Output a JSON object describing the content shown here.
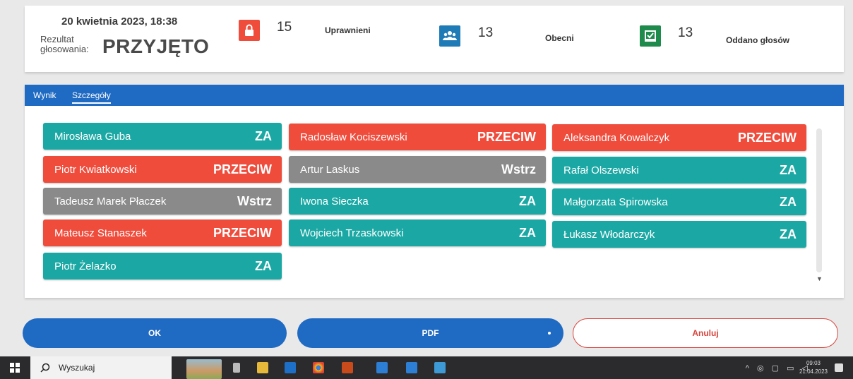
{
  "header": {
    "date": "20 kwietnia 2023, 18:38",
    "result_label": "Rezultat\ngłosowania:",
    "result_value": "PRZYJĘTO",
    "stats": [
      {
        "icon": "lock-icon",
        "count": "15",
        "label": "Uprawnieni",
        "color": "#ef4c3c"
      },
      {
        "icon": "users-icon",
        "count": "13",
        "label": "Obecni",
        "color": "#1f7bb6"
      },
      {
        "icon": "checkbox-icon",
        "count": "13",
        "label": "Oddano głosów",
        "color": "#1e8a4c"
      }
    ]
  },
  "tabs": {
    "result": "Wynik",
    "details": "Szczegóły"
  },
  "votes": [
    {
      "name": "Mirosława Guba",
      "vote": "ZA"
    },
    {
      "name": "Piotr Kwiatkowski",
      "vote": "PRZECIW"
    },
    {
      "name": "Tadeusz Marek Płaczek",
      "vote": "Wstrz"
    },
    {
      "name": "Mateusz Stanaszek",
      "vote": "PRZECIW"
    },
    {
      "name": "Piotr Żelazko",
      "vote": "ZA"
    },
    {
      "name": "Radosław Kociszewski",
      "vote": "PRZECIW"
    },
    {
      "name": "Artur Laskus",
      "vote": "Wstrz"
    },
    {
      "name": "Iwona Sieczka",
      "vote": "ZA"
    },
    {
      "name": "Wojciech Trzaskowski",
      "vote": "ZA"
    },
    {
      "name": "Aleksandra Kowalczyk",
      "vote": "PRZECIW"
    },
    {
      "name": "Rafał Olszewski",
      "vote": "ZA"
    },
    {
      "name": "Małgorzata Spirowska",
      "vote": "ZA"
    },
    {
      "name": "Łukasz Włodarczyk",
      "vote": "ZA"
    }
  ],
  "buttons": {
    "ok": "OK",
    "pdf": "PDF",
    "cancel": "Anuluj"
  },
  "taskbar": {
    "search_placeholder": "Wyszukaj",
    "time": "09:03",
    "date": "21.04.2023"
  },
  "colors": {
    "za": "#1ba8a4",
    "przeciw": "#ef4c3c",
    "wstrz": "#8a8a8a",
    "primary": "#1f6ac2"
  }
}
